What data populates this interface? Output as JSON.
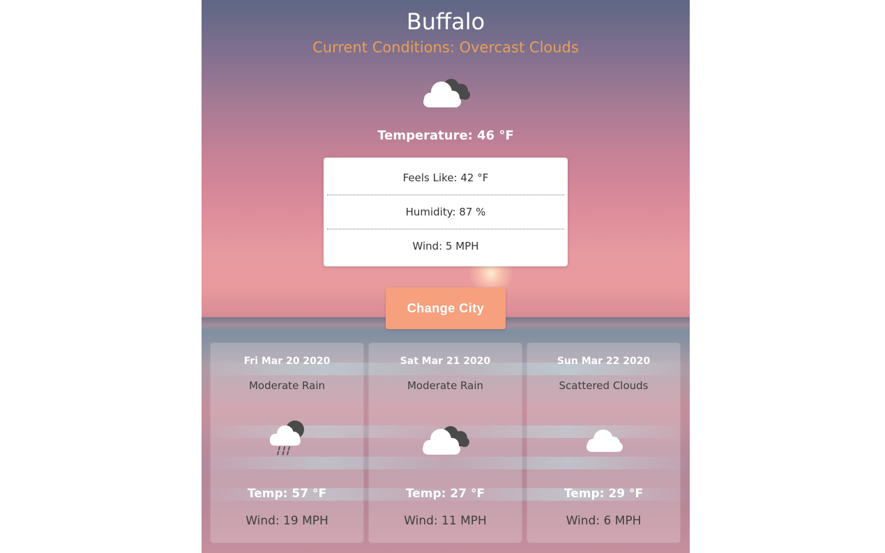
{
  "header": {
    "city": "Buffalo",
    "conditions": "Current Conditions: Overcast Clouds",
    "icon": "overcast-clouds-icon",
    "temperature": "Temperature: 46 °F"
  },
  "details": {
    "feels_like": "Feels Like: 42 °F",
    "humidity": "Humidity: 87 %",
    "wind": "Wind: 5 MPH"
  },
  "actions": {
    "change_city_label": "Change City"
  },
  "forecast": [
    {
      "date": "Fri Mar 20 2020",
      "description": "Moderate Rain",
      "icon": "rain-icon",
      "temp": "Temp: 57 °F",
      "wind": "Wind: 19 MPH"
    },
    {
      "date": "Sat Mar 21 2020",
      "description": "Moderate Rain",
      "icon": "broken-clouds-icon",
      "temp": "Temp: 27 °F",
      "wind": "Wind: 11 MPH"
    },
    {
      "date": "Sun Mar 22 2020",
      "description": "Scattered Clouds",
      "icon": "cloud-icon",
      "temp": "Temp: 29 °F",
      "wind": "Wind: 6 MPH"
    }
  ],
  "colors": {
    "conditions_text": "#e8a055",
    "button_bg": "#f6a07d",
    "panel_bg": "#ffffff"
  }
}
